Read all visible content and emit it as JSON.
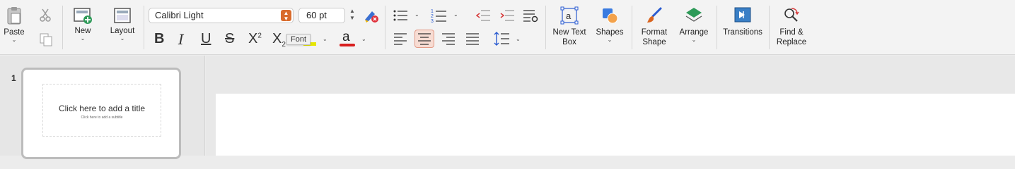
{
  "ribbon": {
    "clipboard": {
      "paste_label": "Paste"
    },
    "slides": {
      "new_label": "New",
      "layout_label": "Layout"
    },
    "font": {
      "family": "Calibri Light",
      "size": "60 pt",
      "tooltip": "Font"
    },
    "format_buttons": {
      "bold": "B",
      "italic": "I",
      "underline": "U",
      "strike": "S",
      "superscript_base": "X",
      "superscript_mark": "2",
      "subscript_base": "X",
      "subscript_mark": "2",
      "font_color_glyph": "a"
    },
    "insert": {
      "text_box_label": "New Text Box",
      "shapes_label": "Shapes"
    },
    "arrange": {
      "format_shape_label": "Format Shape",
      "arrange_label": "Arrange"
    },
    "transitions_label": "Transitions",
    "find_replace_label": "Find & Replace"
  },
  "colors": {
    "accent": "#d96b2b",
    "font_color_bar": "#d81e1e",
    "highlight_bar": "#e6e600",
    "selected_align": "#f7dcd3"
  },
  "slides_panel": {
    "slide_number": "1",
    "thumb_title": "Click here to add a title",
    "thumb_subtitle": "Click here to add a subtitle"
  }
}
